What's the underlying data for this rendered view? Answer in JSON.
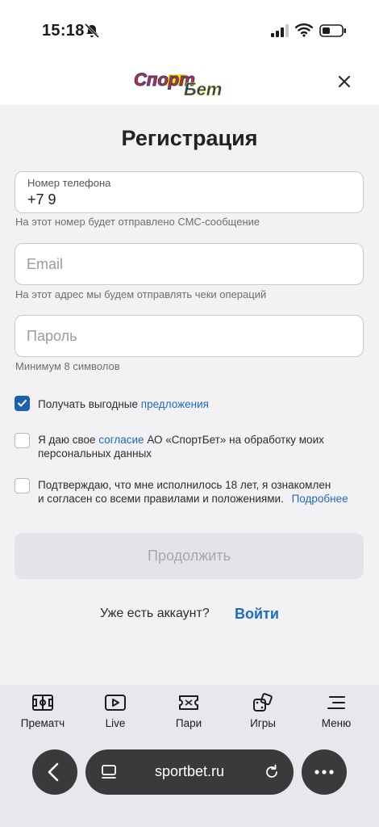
{
  "status_bar": {
    "time": "15:18"
  },
  "header": {
    "logo_text": "СпортБет"
  },
  "form": {
    "title": "Регистрация",
    "phone": {
      "label": "Номер телефона",
      "value": "+7 9",
      "hint": "На этот номер будет отправлено СМС-сообщение"
    },
    "email": {
      "placeholder": "Email",
      "hint": "На этот адрес мы будем отправлять чеки операций"
    },
    "password": {
      "placeholder": "Пароль",
      "hint": "Минимум 8 символов"
    },
    "offers": {
      "checked": true,
      "text": "Получать выгодные",
      "link": "предложения"
    },
    "consent": {
      "checked": false,
      "text_before": "Я даю свое",
      "link": "согласие",
      "text_after": "АО «СпортБет» на обработку моих",
      "line2": "персональных данных"
    },
    "age": {
      "checked": false,
      "line1": "Подтверждаю, что мне исполнилось 18 лет, я ознакомлен",
      "line2": "и согласен со всеми правилами и положениями.",
      "link": "Подробнее"
    },
    "continue_label": "Продолжить",
    "have_account": "Уже есть аккаунт?",
    "login_label": "Войти"
  },
  "tabbar": {
    "items": [
      {
        "label": "Прематч",
        "icon": "field-icon"
      },
      {
        "label": "Live",
        "icon": "play-icon"
      },
      {
        "label": "Пари",
        "icon": "ticket-icon"
      },
      {
        "label": "Игры",
        "icon": "dice-icon"
      },
      {
        "label": "Меню",
        "icon": "menu-icon"
      }
    ]
  },
  "browser": {
    "url": "sportbet.ru"
  },
  "colors": {
    "accent": "#1f6ac1",
    "checkbox": "#1f5fb0",
    "background": "#f2f2f4",
    "button_disabled": "#e4e4e8"
  }
}
